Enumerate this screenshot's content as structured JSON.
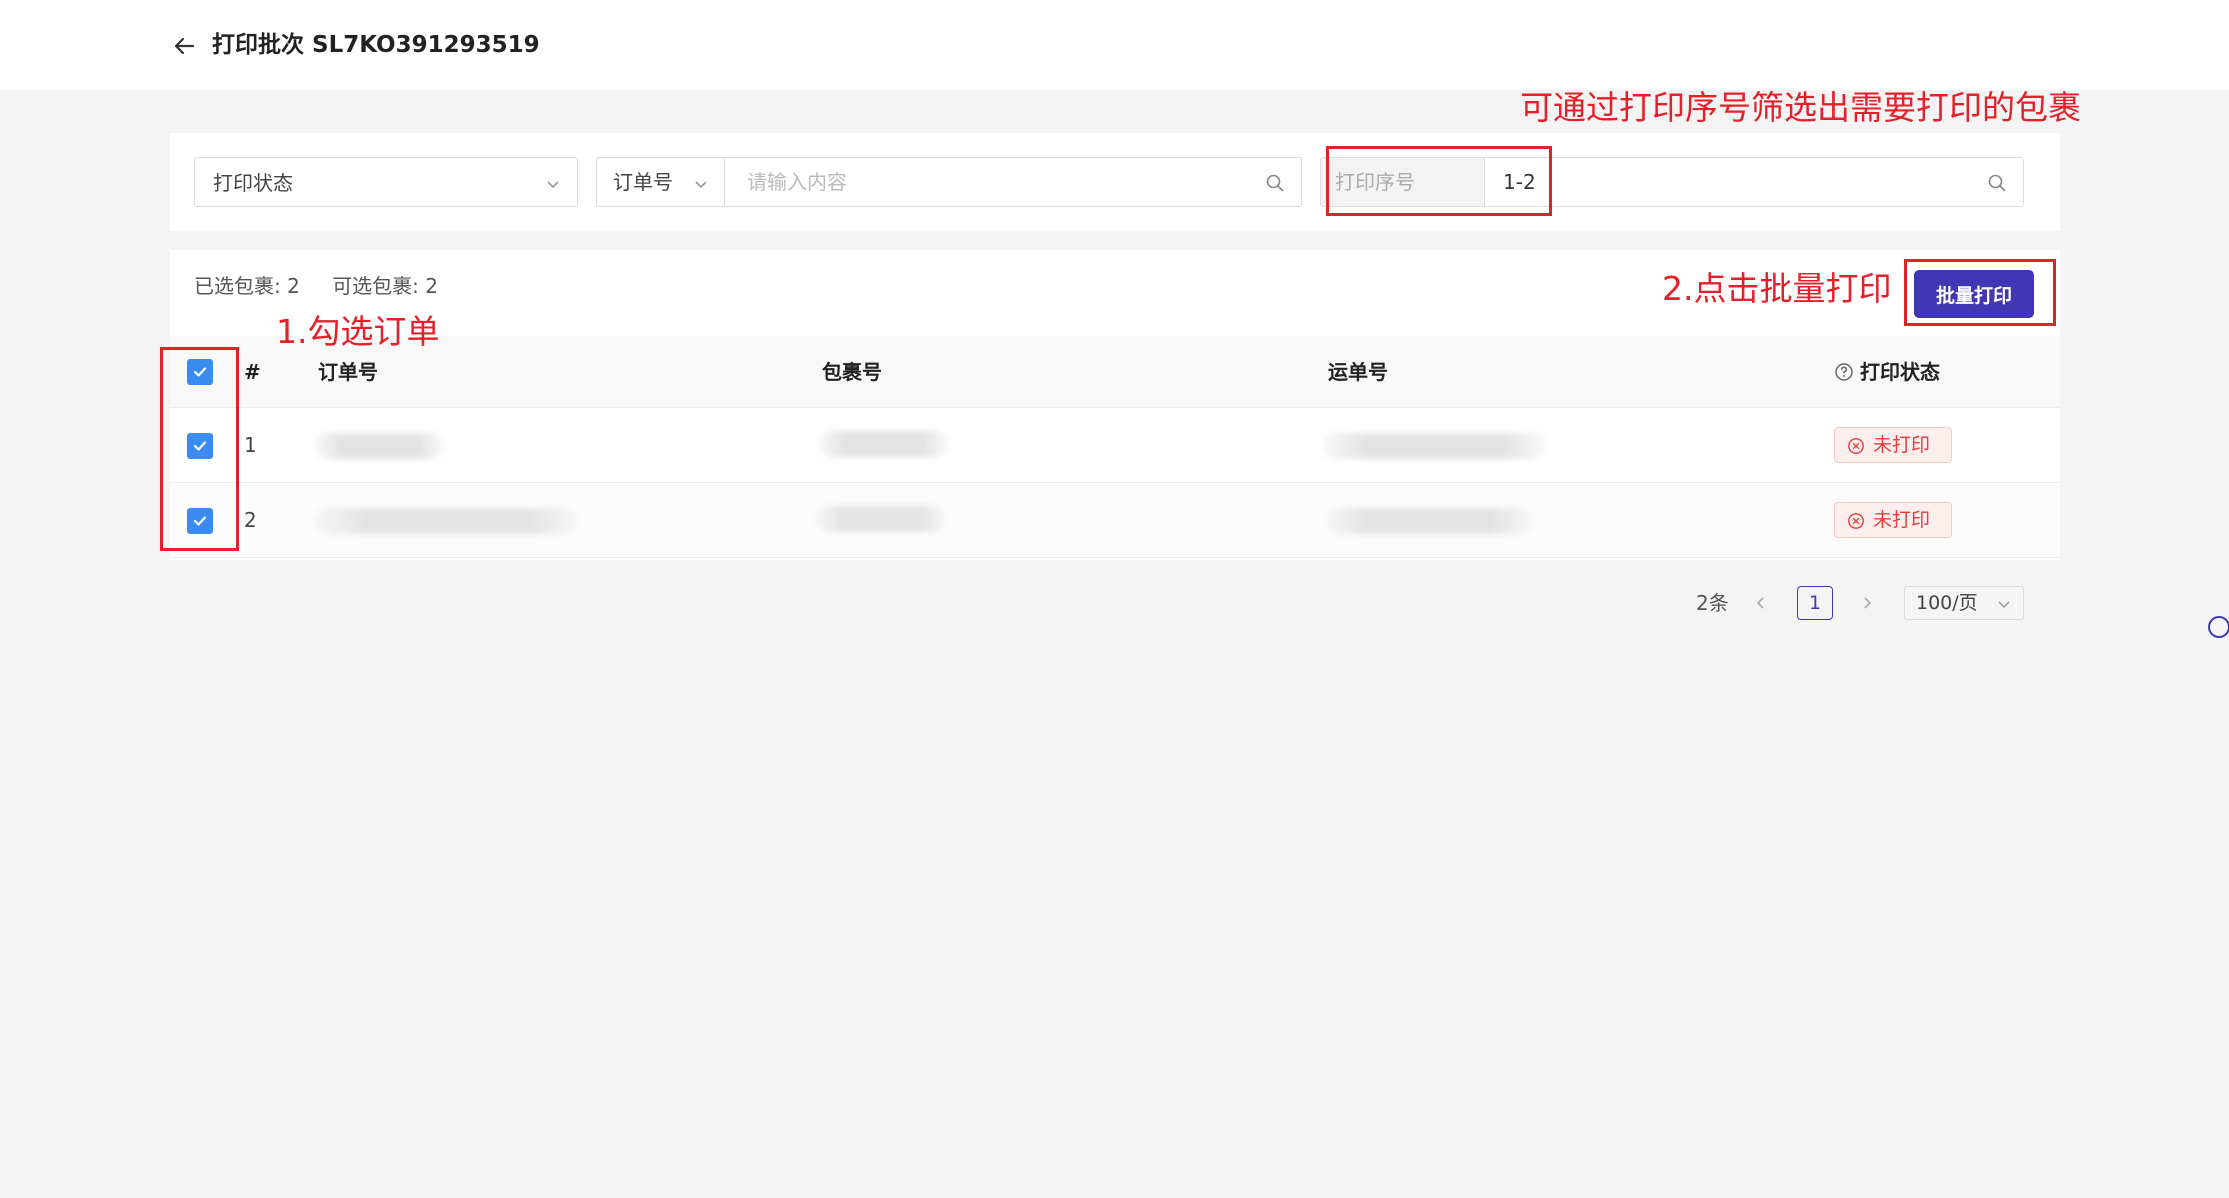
{
  "header": {
    "title": "打印批次 SL7KO391293519",
    "back_icon": "arrow-left-icon"
  },
  "filters": {
    "status_select": {
      "value": "打印状态"
    },
    "order_search": {
      "field": "订单号",
      "placeholder": "请输入内容"
    },
    "serial_search": {
      "prefix_placeholder": "打印序号",
      "value": "1-2"
    }
  },
  "toolbar": {
    "selected_label": "已选包裹: 2",
    "available_label": "可选包裹: 2",
    "batch_print": "批量打印"
  },
  "table": {
    "columns": [
      "#",
      "订单号",
      "包裹号",
      "运单号",
      "打印状态"
    ],
    "rows": [
      {
        "index": "1",
        "status": "未打印",
        "checked": true
      },
      {
        "index": "2",
        "status": "未打印",
        "checked": true
      }
    ]
  },
  "pagination": {
    "total": "2条",
    "current_page": "1",
    "page_size": "100/页"
  },
  "annotations": {
    "filter_tip": "可通过打印序号筛选出需要打印的包裹",
    "step1": "1.勾选订单",
    "step2": "2.点击批量打印",
    "color": "#e5202a"
  },
  "colors": {
    "primary": "#4236b4",
    "checkbox": "#3b8cf0",
    "status_error": "#e53d3d"
  }
}
